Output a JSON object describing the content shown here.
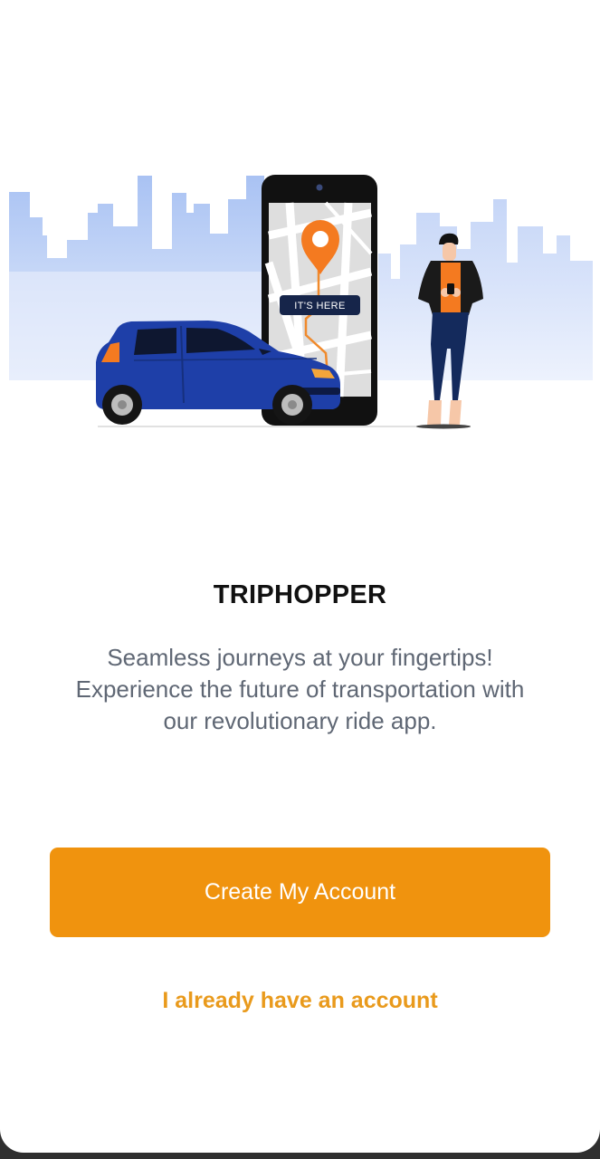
{
  "app": {
    "title": "TRIPHOPPER",
    "tagline_lines": [
      "Seamless journeys at your fingertips!",
      "Experience the future of transportation with",
      "our revolutionary ride app."
    ]
  },
  "illustration": {
    "pin_label": "IT'S HERE"
  },
  "actions": {
    "create_account_label": "Create My Account",
    "login_label": "I already have an account"
  },
  "colors": {
    "accent": "#f0930e",
    "link": "#e99a1c",
    "car": "#1e3fa8",
    "pin": "#f47a20"
  }
}
